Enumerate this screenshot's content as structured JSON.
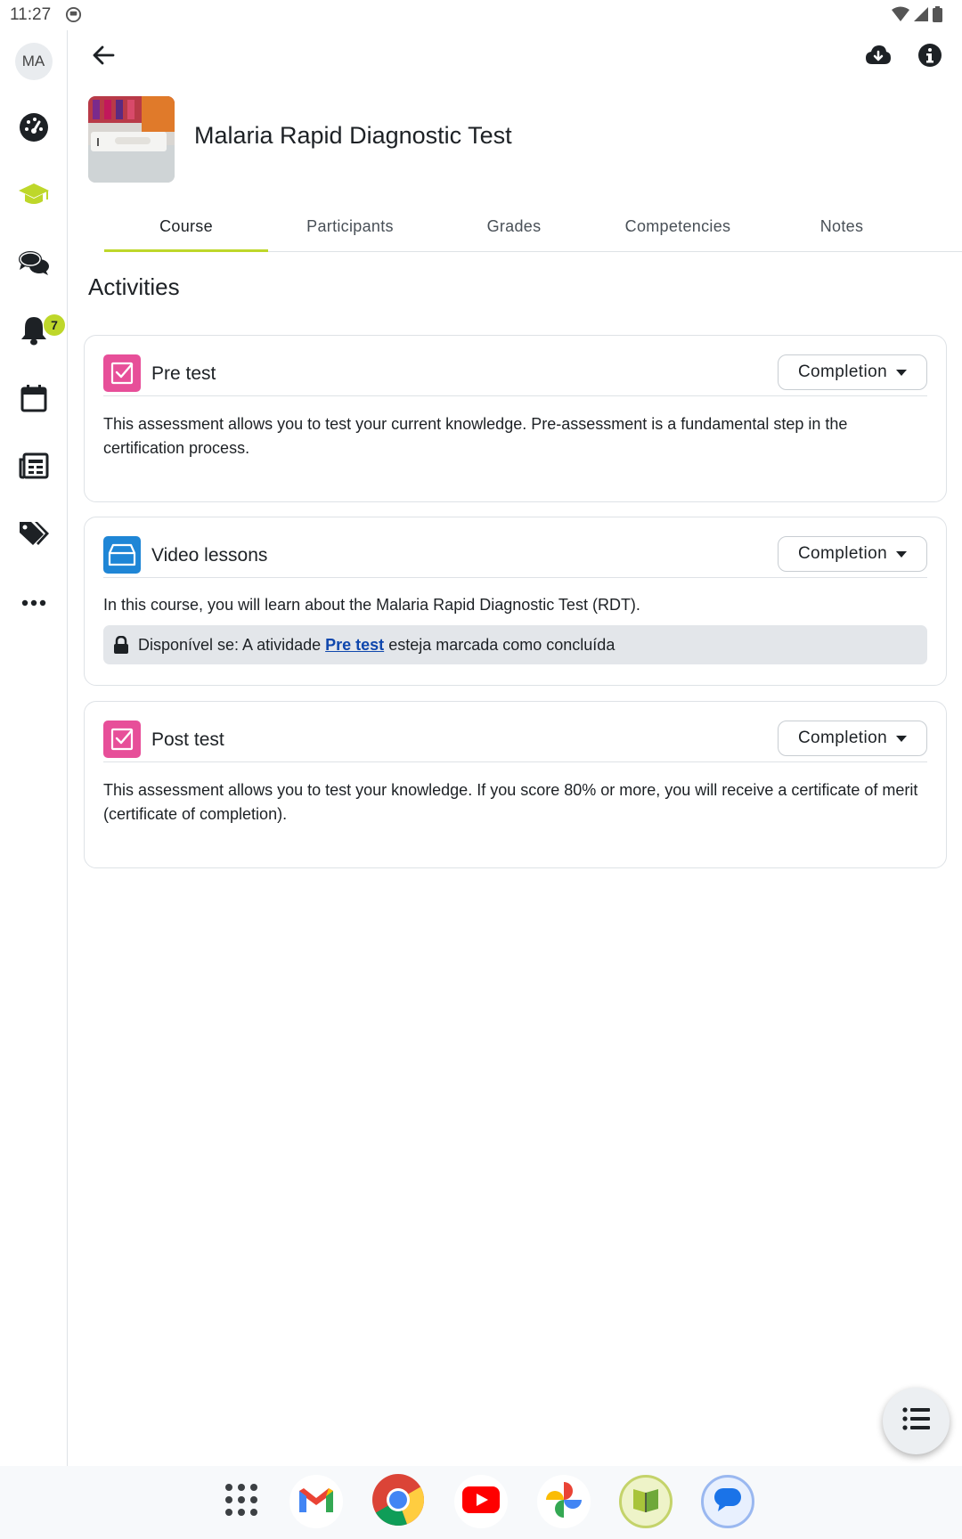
{
  "status_bar": {
    "time": "11:27"
  },
  "rail": {
    "avatar_initials": "MA",
    "notification_count": "7"
  },
  "course": {
    "title": "Malaria Rapid Diagnostic Test"
  },
  "tabs": [
    {
      "label": "Course",
      "active": true
    },
    {
      "label": "Participants",
      "active": false
    },
    {
      "label": "Grades",
      "active": false
    },
    {
      "label": "Competencies",
      "active": false
    },
    {
      "label": "Notes",
      "active": false
    }
  ],
  "section": {
    "title": "Activities"
  },
  "activities": [
    {
      "name": "Pre test",
      "type": "quiz",
      "completion_label": "Completion",
      "description": "This assessment allows you to test your current knowledge. Pre-assessment is a fundamental step in the certification process."
    },
    {
      "name": "Video lessons",
      "type": "page",
      "completion_label": "Completion",
      "description": "In this course, you will learn about the Malaria Rapid Diagnostic Test (RDT).",
      "restriction": {
        "prefix": "Disponível se: A atividade",
        "link": "Pre test",
        "suffix": "esteja marcada como concluída"
      }
    },
    {
      "name": "Post test",
      "type": "quiz",
      "completion_label": "Completion",
      "description": "This assessment allows you to test your knowledge. If you score 80% or more, you will receive a certificate of merit (certificate of completion)."
    }
  ],
  "colors": {
    "accent": "#bed72a",
    "quiz_icon": "#e74f99",
    "page_icon": "#1f86d6",
    "link": "#0f47ad"
  }
}
